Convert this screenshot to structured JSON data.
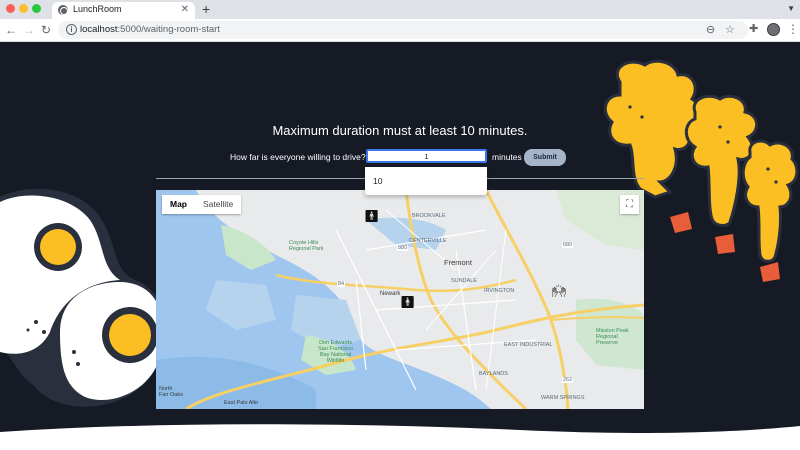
{
  "browser": {
    "tab_title": "LunchRoom",
    "url_host": "localhost",
    "url_rest": ":5000/waiting-room-start",
    "icons": [
      "back-icon",
      "forward-icon",
      "reload-icon",
      "info-icon",
      "zoom-icon",
      "star-icon",
      "extensions-icon",
      "profile-avatar",
      "menu-icon"
    ]
  },
  "page": {
    "message": "Maximum duration must at least 10 minutes.",
    "drive_label": "How far is everyone willing to drive?",
    "drive_value": "1",
    "suggestion": "10",
    "minutes_label": "minutes",
    "submit_label": "Submit"
  },
  "map": {
    "type_options": [
      "Map",
      "Satellite"
    ],
    "selected_type": "Map",
    "labels": {
      "fremont": "Fremont",
      "newark": "Newark",
      "coyote": [
        "Coyote Hills",
        "Regional Park"
      ],
      "don_edwards": [
        "Don Edwards",
        "San Francisco",
        "Bay National",
        "Wildlife"
      ],
      "mission_peak": [
        "Mission Peak",
        "Regional",
        "Preserve"
      ],
      "centerville": "CENTERVILLE",
      "brookvale": "BROOKVALE",
      "sundale": "SUNDALE",
      "irvington": "IRVINGTON",
      "east_industrial": "EAST INDUSTRIAL",
      "baylands": "BAYLANDS",
      "warm_springs": "WARM SPRINGS",
      "north_fair_oaks": [
        "North",
        "Fair Oaks"
      ],
      "east_palo_alto": "East Palo Alto"
    },
    "route_numbers": [
      "84",
      "880",
      "680",
      "262"
    ]
  },
  "colors": {
    "background": "#161a24",
    "accent_blue": "#3b78e7",
    "submit_bg": "#a5b5c9",
    "egg_yolk": "#fbbf24",
    "rocket_fire": "#e85d3a"
  }
}
